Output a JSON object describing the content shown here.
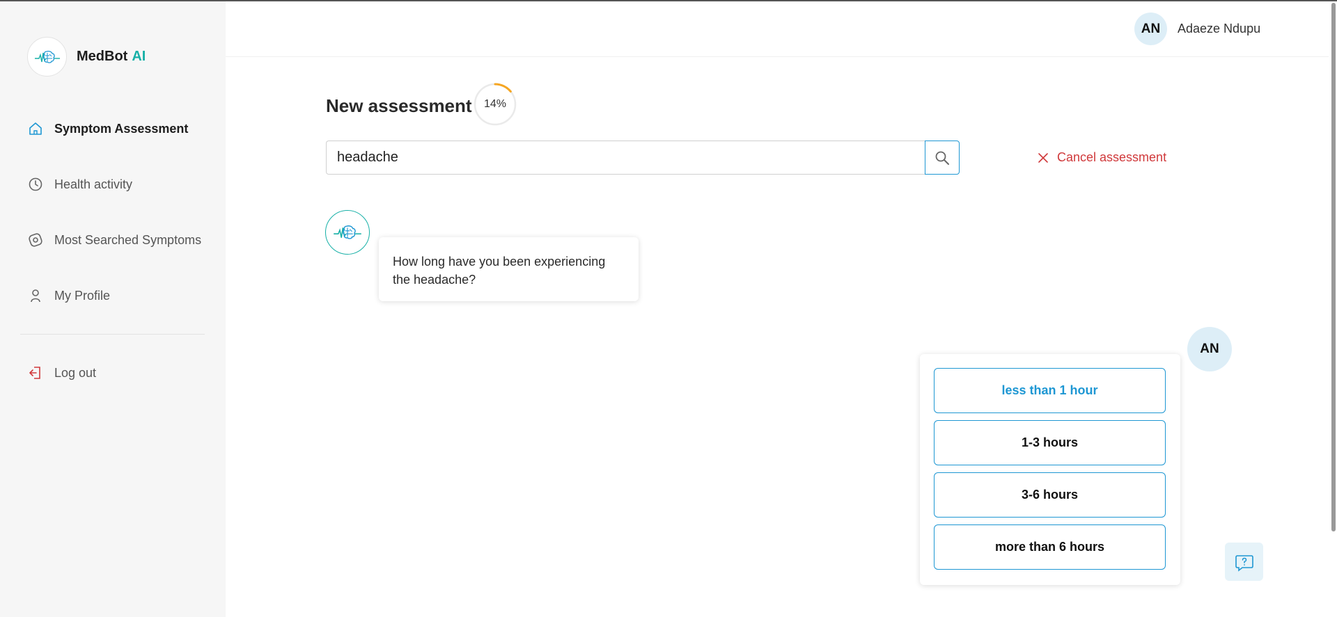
{
  "app": {
    "brand_name": "MedBot",
    "brand_suffix": "AI",
    "accent_color": "#17b0a7",
    "link_color": "#1e97d3",
    "danger_color": "#d0393b"
  },
  "sidebar": {
    "items": [
      {
        "label": "Symptom Assessment",
        "icon": "home-icon",
        "active": true
      },
      {
        "label": "Health activity",
        "icon": "clock-icon",
        "active": false
      },
      {
        "label": "Most Searched Symptoms",
        "icon": "compass-icon",
        "active": false
      },
      {
        "label": "My Profile",
        "icon": "user-icon",
        "active": false
      }
    ],
    "logout_label": "Log out"
  },
  "header": {
    "user_initials": "AN",
    "user_name": "Adaeze Ndupu"
  },
  "assessment": {
    "title": "New assessment",
    "progress_percent": 14,
    "progress_label": "14%",
    "search_value": "headache",
    "cancel_label": "Cancel assessment"
  },
  "chat": {
    "bot_question": "How long have you been experiencing the headache?",
    "user_initials": "AN",
    "options": [
      {
        "label": "less than 1 hour",
        "selected": true
      },
      {
        "label": "1-3 hours",
        "selected": false
      },
      {
        "label": "3-6 hours",
        "selected": false
      },
      {
        "label": "more than 6 hours",
        "selected": false
      }
    ]
  }
}
